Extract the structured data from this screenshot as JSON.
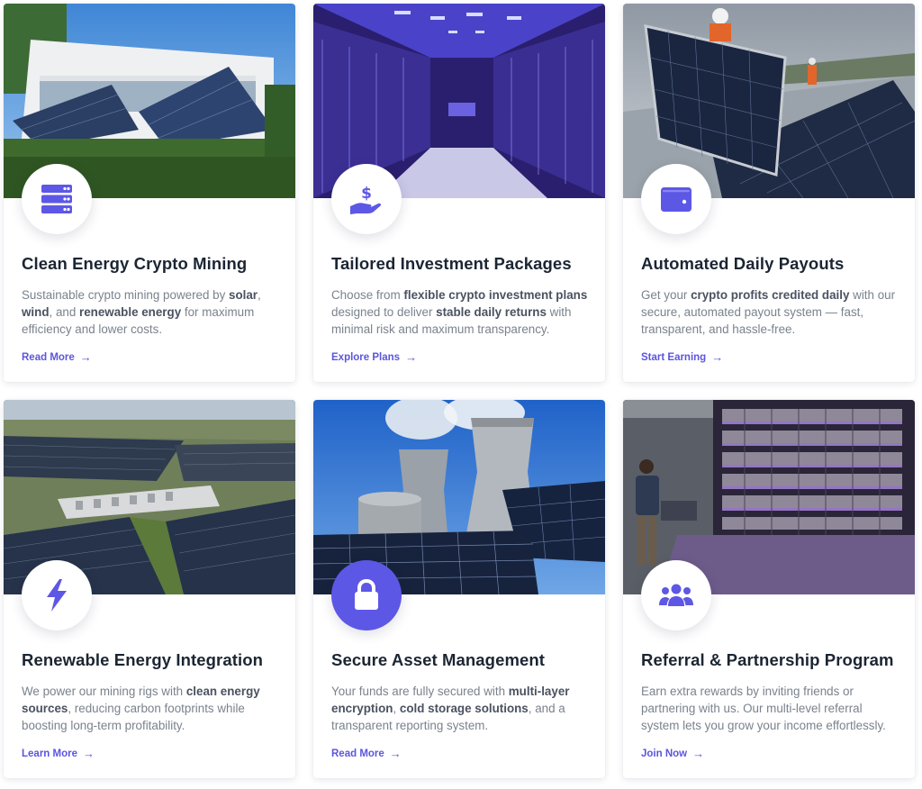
{
  "colors": {
    "accent": "#5d57e6",
    "heading": "#1b2533",
    "body_text": "#7a828d",
    "link": "#5b55de"
  },
  "cards": [
    {
      "title": "Clean Energy Crypto Mining",
      "icon": "server-icon",
      "image": "solar-panels-building",
      "desc": [
        {
          "t": "Sustainable crypto mining powered by "
        },
        {
          "t": "solar",
          "b": true
        },
        {
          "t": ", "
        },
        {
          "t": "wind",
          "b": true
        },
        {
          "t": ", and "
        },
        {
          "t": "renewable energy",
          "b": true
        },
        {
          "t": " for maximum efficiency and lower costs."
        }
      ],
      "cta": "Read More"
    },
    {
      "title": "Tailored Investment Packages",
      "icon": "hand-dollar-icon",
      "image": "mining-rig-datacenter",
      "desc": [
        {
          "t": "Choose from "
        },
        {
          "t": "flexible crypto investment plans",
          "b": true
        },
        {
          "t": " designed to deliver "
        },
        {
          "t": "stable daily returns",
          "b": true
        },
        {
          "t": " with minimal risk and maximum transparency."
        }
      ],
      "cta": "Explore Plans"
    },
    {
      "title": "Automated Daily Payouts",
      "icon": "wallet-icon",
      "image": "solar-installers",
      "desc": [
        {
          "t": "Get your "
        },
        {
          "t": "crypto profits credited daily",
          "b": true
        },
        {
          "t": " with our secure, automated payout system — fast, transparent, and hassle-free."
        }
      ],
      "cta": "Start Earning"
    },
    {
      "title": "Renewable Energy Integration",
      "icon": "lightning-icon",
      "image": "solar-farm-aerial",
      "desc": [
        {
          "t": "We power our mining rigs with "
        },
        {
          "t": "clean energy sources",
          "b": true
        },
        {
          "t": ", reducing carbon footprints while boosting long-term profitability."
        }
      ],
      "cta": "Learn More"
    },
    {
      "title": "Secure Asset Management",
      "icon": "lock-icon",
      "image": "cooling-towers-solar",
      "desc": [
        {
          "t": "Your funds are fully secured with "
        },
        {
          "t": "multi-layer encryption",
          "b": true
        },
        {
          "t": ", "
        },
        {
          "t": "cold storage solutions",
          "b": true
        },
        {
          "t": ", and a transparent reporting system."
        }
      ],
      "cta": "Read More"
    },
    {
      "title": "Referral & Partnership Program",
      "icon": "users-icon",
      "image": "mining-technician",
      "desc": [
        {
          "t": "Earn extra rewards by inviting friends or partnering with us. Our multi-level referral system lets you grow your income effortlessly."
        }
      ],
      "cta": "Join Now"
    }
  ]
}
